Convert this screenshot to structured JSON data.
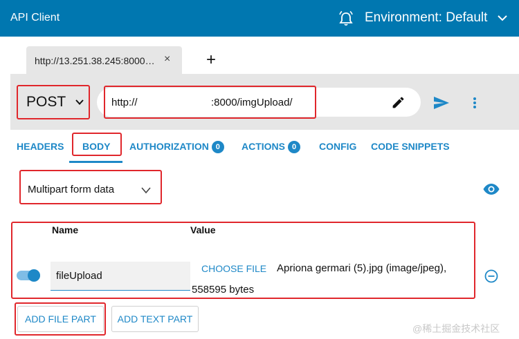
{
  "header": {
    "app_title": "API Client",
    "environment_label": "Environment: Default",
    "accent": "#0077b0"
  },
  "tabs": [
    {
      "label": "http://13.251.38.245:8000…",
      "close": "×"
    }
  ],
  "new_tab_symbol": "+",
  "request": {
    "method": "POST",
    "url_prefix": "http://",
    "url_suffix": ":8000/imgUpload/"
  },
  "subtabs": [
    {
      "label": "HEADERS"
    },
    {
      "label": "BODY",
      "active": true
    },
    {
      "label": "AUTHORIZATION",
      "badge": "0"
    },
    {
      "label": "ACTIONS",
      "badge": "0"
    },
    {
      "label": "CONFIG"
    },
    {
      "label": "CODE SNIPPETS"
    }
  ],
  "body": {
    "type": "Multipart form data",
    "columns": {
      "name": "Name",
      "value": "Value"
    },
    "parts": [
      {
        "enabled": true,
        "name": "fileUpload",
        "choose_label": "CHOOSE FILE",
        "file_line1": "Apriona germari (5).jpg (image/jpeg),",
        "file_line2": "558595 bytes"
      }
    ],
    "add_file_part": "ADD FILE PART",
    "add_text_part": "ADD TEXT PART"
  },
  "watermark": "@稀土掘金技术社区",
  "icons": [
    "bell-icon",
    "chevron-down-icon",
    "close-icon",
    "add-icon",
    "pencil-icon",
    "send-icon",
    "more-vert-icon",
    "eye-icon",
    "remove-circle-icon"
  ]
}
